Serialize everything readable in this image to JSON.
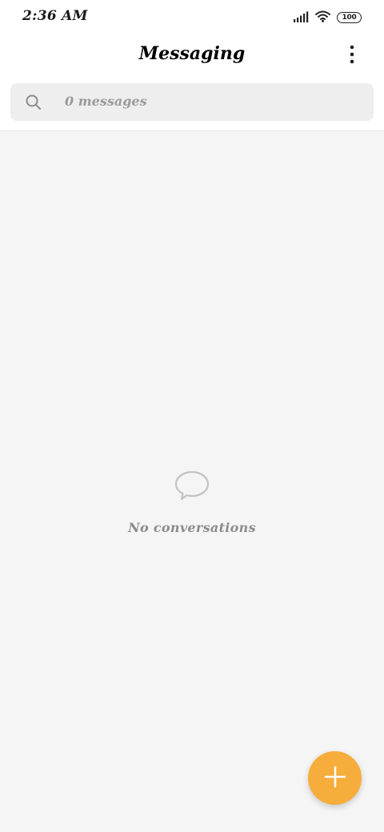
{
  "status_bar": {
    "time": "2:36 AM",
    "battery_level": "100",
    "icons": [
      "signal-icon",
      "wifi-icon",
      "battery-icon"
    ]
  },
  "header": {
    "title": "Messaging",
    "menu_icon": "more-vert-icon"
  },
  "search": {
    "icon": "search-icon",
    "placeholder": "0 messages"
  },
  "empty_state": {
    "icon": "chat-bubble-icon",
    "text": "No conversations"
  },
  "fab": {
    "icon": "plus-icon",
    "color": "#f6ad3b"
  },
  "colors": {
    "background": "#f5f5f5",
    "header_background": "#ffffff",
    "search_background": "#eeeeee",
    "accent": "#f6ad3b"
  }
}
